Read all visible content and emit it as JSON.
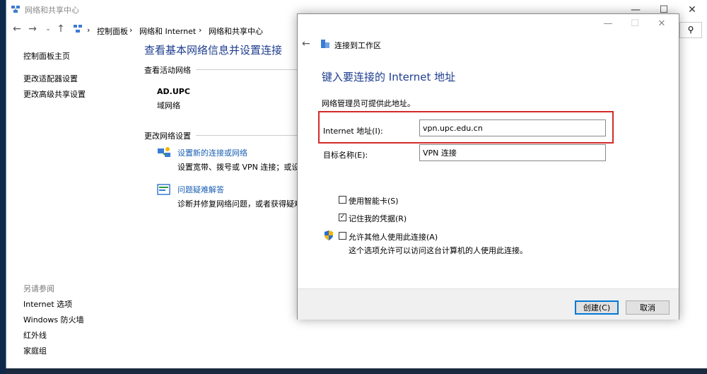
{
  "bg_window": {
    "title": "网络和共享中心",
    "breadcrumb": [
      "控制面板",
      "网络和 Internet",
      "网络和共享中心"
    ],
    "left_pane": {
      "home": "控制面板主页",
      "links": [
        "更改适配器设置",
        "更改高级共享设置"
      ],
      "see_also_header": "另请参阅",
      "see_also": [
        "Internet 选项",
        "Windows 防火墙",
        "红外线",
        "家庭组"
      ]
    },
    "main": {
      "heading": "查看基本网络信息并设置连接",
      "active_networks_header": "查看活动网络",
      "network_name": "AD.UPC",
      "network_type": "域网络",
      "change_settings_header": "更改网络设置",
      "task1_title": "设置新的连接或网络",
      "task1_desc": "设置宽带、拨号或 VPN 连接；或设置",
      "task2_title": "问题疑难解答",
      "task2_desc": "诊断并修复网络问题，或者获得疑难解"
    }
  },
  "dialog": {
    "title": "连接到工作区",
    "heading": "键入要连接的 Internet 地址",
    "note": "网络管理员可提供此地址。",
    "address_label": "Internet 地址(I):",
    "address_value": "vpn.upc.edu.cn",
    "dest_label": "目标名称(E):",
    "dest_value": "VPN 连接",
    "smartcard_label": "使用智能卡(S)",
    "smartcard_checked": false,
    "remember_label": "记住我的凭据(R)",
    "remember_checked": true,
    "allow_label": "允许其他人使用此连接(A)",
    "allow_checked": false,
    "allow_desc": "这个选项允许可以访问这台计算机的人使用此连接。",
    "create_button": "创建(C)",
    "cancel_button": "取消"
  },
  "colors": {
    "heading_blue": "#1e3d8f",
    "link_blue": "#1a5fb4",
    "highlight_red": "#d42a2a"
  }
}
